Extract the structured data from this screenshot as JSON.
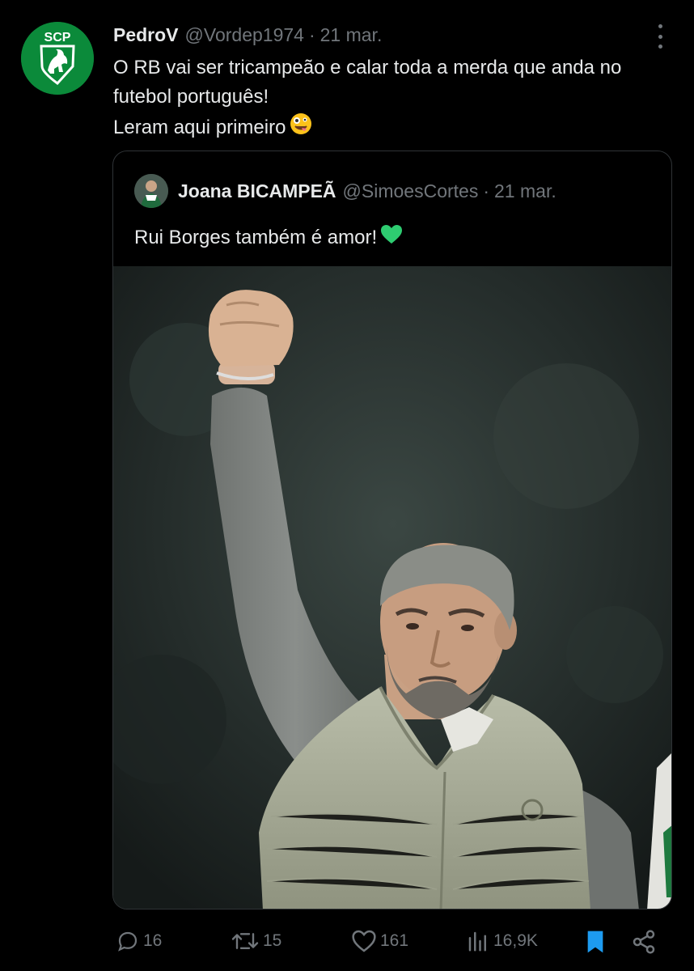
{
  "tweet": {
    "display_name": "PedroV",
    "handle": "@Vordep1974",
    "separator": "·",
    "date": "21 mar.",
    "avatar_icon": "sporting-crest-icon",
    "avatar_text": "SCP",
    "lines": [
      "O RB vai ser tricampeão e calar toda a merda que anda no",
      "futebol português!",
      "Leram aqui primeiro"
    ],
    "emoji": "zany-face-emoji"
  },
  "quote": {
    "display_name": "Joana BICAMPEÃ",
    "handle": "@SimoesCortes",
    "separator": "·",
    "date": "21 mar.",
    "text": "Rui Borges também é amor!",
    "emoji": "green-heart-emoji",
    "image": "photo-coach-raised-fist"
  },
  "actions": {
    "replies": "16",
    "retweets": "15",
    "likes": "161",
    "views": "16,9K"
  },
  "colors": {
    "background": "#000000",
    "text": "#e7e9ea",
    "muted": "#71767b",
    "accent": "#1d9bf0",
    "brand_green": "#0b8a3a"
  }
}
